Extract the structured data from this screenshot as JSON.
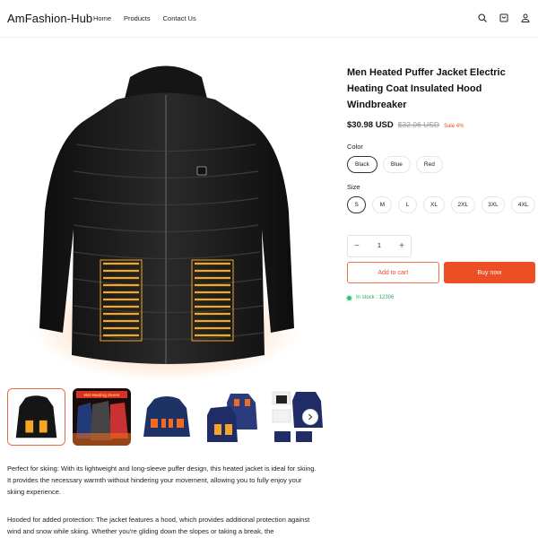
{
  "header": {
    "logo": "AmFashion-Hub",
    "nav": [
      "Home",
      "Products",
      "Contact Us"
    ],
    "icons": [
      "search-icon",
      "cart-icon",
      "user-icon"
    ]
  },
  "product": {
    "title": "Men Heated Puffer Jacket Electric Heating Coat Insulated Hood Windbreaker",
    "price": "$30.98 USD",
    "old_price": "$32.06 USD",
    "sale_badge": "Sale 4%",
    "color_label": "Color",
    "colors": [
      "Black",
      "Blue",
      "Red"
    ],
    "selected_color": "Black",
    "size_label": "Size",
    "sizes": [
      "S",
      "M",
      "L",
      "XL",
      "2XL",
      "3XL",
      "4XL"
    ],
    "selected_size": "S",
    "quantity": "1",
    "qty_minus": "−",
    "qty_plus": "+",
    "add_to_cart": "Add to cart",
    "buy_now": "Buy now",
    "stock": "In stock : 12306"
  },
  "thumbnails": {
    "count": 5,
    "banner_text": "Hot Heating Zones"
  },
  "description": [
    "Perfect for skiing: With its lightweight and long-sleeve puffer design, this heated jacket is ideal for skiing. It provides the necessary warmth without hindering your movement, allowing you to fully enjoy your skiing experience.",
    "Hooded for added protection: The jacket features a hood, which provides additional protection against wind and snow while skiing. Whether you're gliding down the slopes or taking a break, the"
  ],
  "colors": {
    "accent": "#ec4f24",
    "stock_green": "#2aaa5e",
    "heat_orange": "#f2a52a"
  }
}
